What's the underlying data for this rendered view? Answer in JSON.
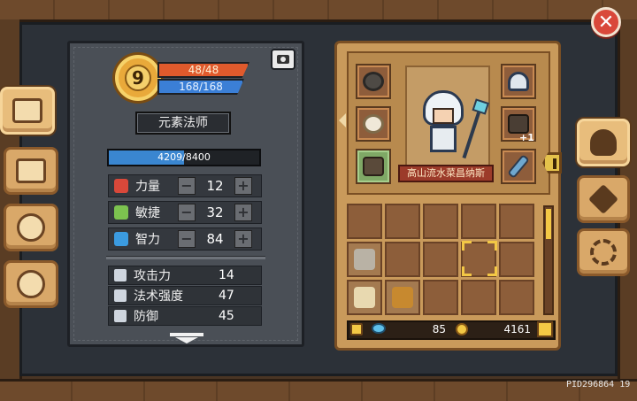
{
  "header": {
    "close_label": "✕"
  },
  "character": {
    "level": "9",
    "hp": "48/48",
    "mp": "168/168",
    "class_name": "元素法师",
    "exp": {
      "text": "4209/8400",
      "current": 4209,
      "max": 8400
    }
  },
  "attributes": [
    {
      "label": "力量",
      "value": "12",
      "icon": "fist-icon",
      "color": "#d9483a",
      "minus": "−",
      "plus": "+"
    },
    {
      "label": "敏捷",
      "value": "32",
      "icon": "feather-icon",
      "color": "#7cc24f",
      "minus": "−",
      "plus": "+"
    },
    {
      "label": "智力",
      "value": "84",
      "icon": "book-icon",
      "color": "#3b9be0",
      "minus": "−",
      "plus": "+"
    }
  ],
  "stats": [
    {
      "label": "攻击力",
      "value": "14",
      "icon": "sword-icon"
    },
    {
      "label": "法术强度",
      "value": "47",
      "icon": "wand-icon"
    },
    {
      "label": "防御",
      "value": "45",
      "icon": "shield-icon"
    }
  ],
  "equipment": {
    "weapon_name": "高山流水菜昌纳斯",
    "chest_enhance": "+1",
    "slots": [
      "necklace-icon",
      "ring-icon",
      "boots-icon",
      "helmet-icon",
      "armor-icon",
      "staff-icon"
    ]
  },
  "inventory": {
    "items": [
      "medal-icon",
      "scroll-icon",
      "feather-quill-icon"
    ]
  },
  "currency": {
    "gems": "85",
    "gold": "4161"
  },
  "tabs_left": [
    "book-tab",
    "scroll-tab",
    "pet-tab",
    "shield-tab"
  ],
  "tabs_right": [
    "helmet-tab",
    "cross-weapons-tab",
    "settings-tab"
  ],
  "footer": {
    "pid": "PID296864  19"
  }
}
